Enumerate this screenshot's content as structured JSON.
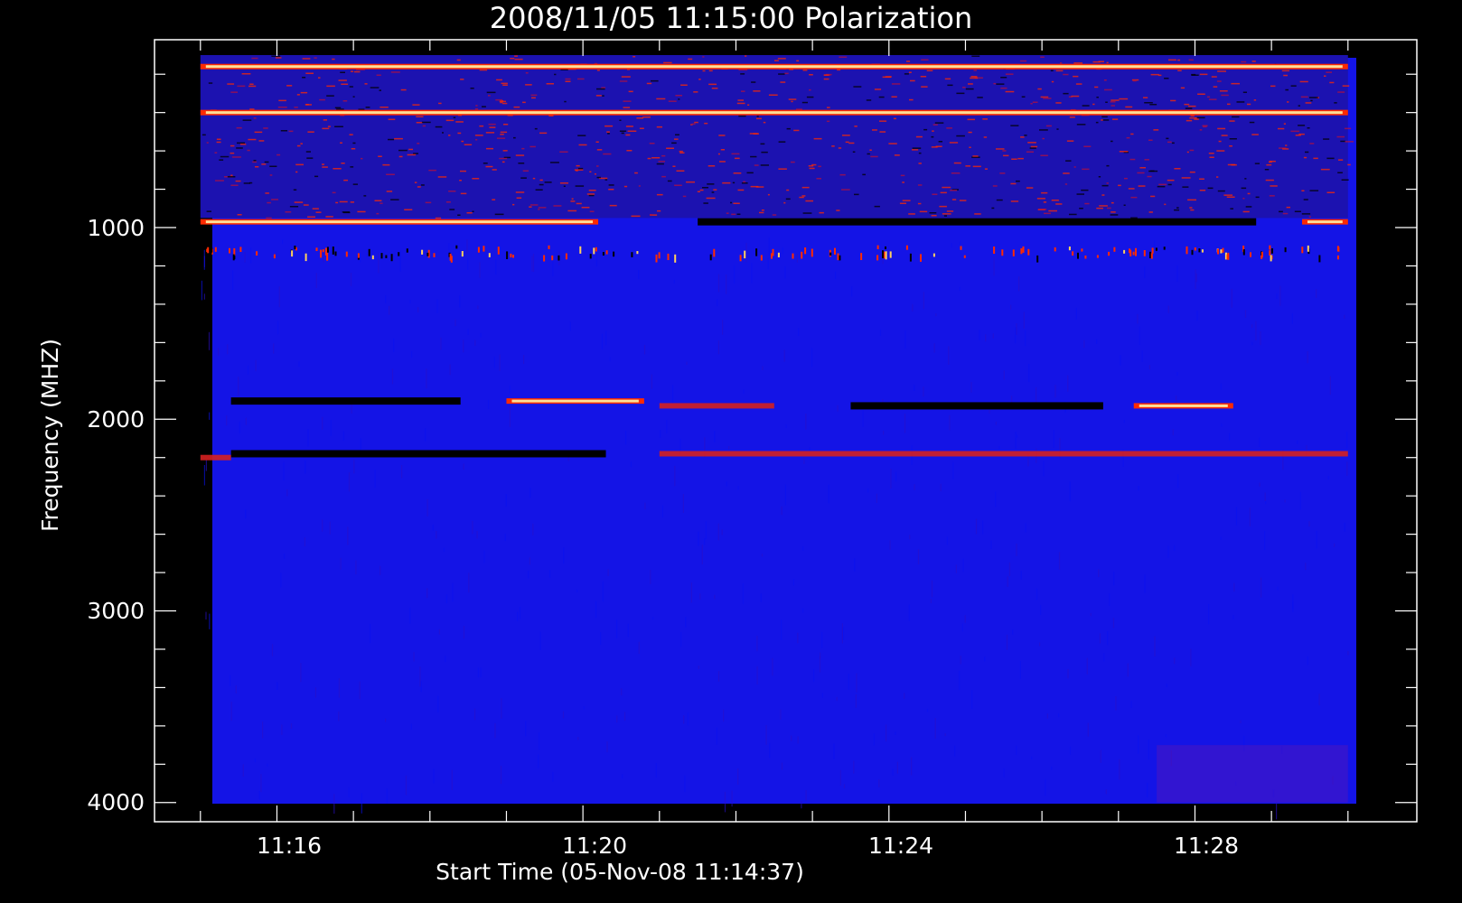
{
  "chart_data": {
    "type": "heatmap",
    "title": "2008/11/05 11:15:00 Polarization",
    "xlabel": "Start Time (05-Nov-08 11:14:37)",
    "ylabel": "Frequency (MHZ)",
    "x_ticks": [
      "11:16",
      "11:20",
      "11:24",
      "11:28"
    ],
    "x_tick_minutes": [
      16,
      20,
      24,
      28
    ],
    "y_ticks": [
      "1000",
      "2000",
      "3000",
      "4000"
    ],
    "y_tick_values": [
      1000,
      2000,
      3000,
      4000
    ],
    "xlim_minutes": [
      14.4,
      30.9
    ],
    "ylim": [
      20,
      4100
    ],
    "data_extent": {
      "x_minutes": [
        15.0,
        30.0
      ],
      "y": [
        100,
        4000
      ]
    },
    "y_inverted": true,
    "colors": {
      "background": "#000000",
      "foreground": "#ffffff",
      "low": "#1414e6",
      "high": "#ff2a00",
      "peak": "#fff2a8"
    },
    "features": [
      {
        "kind": "noisy-band",
        "y_range": [
          100,
          950
        ],
        "x_range": [
          15.0,
          30.0
        ]
      },
      {
        "kind": "bright-line",
        "y": 160,
        "x_range": [
          15.0,
          30.0
        ]
      },
      {
        "kind": "bright-line",
        "y": 400,
        "x_range": [
          15.0,
          30.0
        ]
      },
      {
        "kind": "bright-line",
        "y": 970,
        "x_range": [
          15.0,
          20.2
        ]
      },
      {
        "kind": "bright-line",
        "y": 970,
        "x_range": [
          29.4,
          30.0
        ]
      },
      {
        "kind": "dark-line",
        "y": 970,
        "x_range": [
          21.5,
          28.8
        ]
      },
      {
        "kind": "speckle-line",
        "y": 1120,
        "x_range": [
          15.0,
          30.0
        ]
      },
      {
        "kind": "bright-line",
        "y": 1905,
        "x_range": [
          19.0,
          20.8
        ]
      },
      {
        "kind": "red-line",
        "y": 1930,
        "x_range": [
          21.0,
          22.5
        ]
      },
      {
        "kind": "dark-line",
        "y": 1905,
        "x_range": [
          15.4,
          18.4
        ]
      },
      {
        "kind": "dark-line",
        "y": 1930,
        "x_range": [
          23.5,
          26.8
        ]
      },
      {
        "kind": "bright-line",
        "y": 1930,
        "x_range": [
          27.2,
          28.5
        ]
      },
      {
        "kind": "dark-line",
        "y": 2180,
        "x_range": [
          15.4,
          20.3
        ]
      },
      {
        "kind": "red-line",
        "y": 2200,
        "x_range": [
          15.0,
          15.4
        ]
      },
      {
        "kind": "red-line",
        "y": 2180,
        "x_range": [
          21.0,
          30.0
        ]
      }
    ]
  }
}
